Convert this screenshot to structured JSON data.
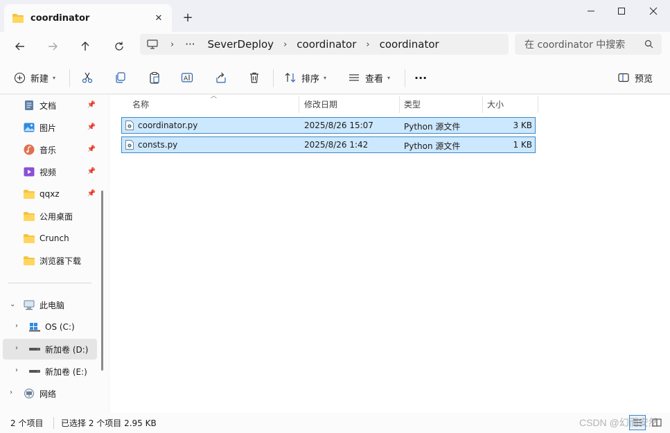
{
  "window": {
    "tab_title": "coordinator",
    "tab_icon": "folder-icon",
    "new_tab": "+",
    "controls": [
      "minimize",
      "maximize",
      "close"
    ]
  },
  "address": {
    "crumbs": [
      "SeverDeploy",
      "coordinator",
      "coordinator"
    ],
    "ellipsis": "···",
    "search_placeholder": "在 coordinator 中搜索"
  },
  "toolbar": {
    "new_label": "新建",
    "sort_label": "排序",
    "view_label": "查看",
    "more_label": "···",
    "preview_label": "预览"
  },
  "sidebar": {
    "quick": [
      {
        "label": "文档",
        "icon": "documents-icon"
      },
      {
        "label": "图片",
        "icon": "pictures-icon"
      },
      {
        "label": "音乐",
        "icon": "music-icon"
      },
      {
        "label": "视频",
        "icon": "videos-icon"
      },
      {
        "label": "qqxz",
        "icon": "folder-icon"
      },
      {
        "label": "公用桌面",
        "icon": "folder-icon"
      },
      {
        "label": "Crunch",
        "icon": "folder-icon"
      },
      {
        "label": "浏览器下载",
        "icon": "folder-icon"
      }
    ],
    "this_pc": "此电脑",
    "drives": [
      {
        "label": "OS (C:)",
        "icon": "windows-drive-icon"
      },
      {
        "label": "新加卷 (D:)",
        "icon": "drive-icon"
      },
      {
        "label": "新加卷 (E:)",
        "icon": "drive-icon"
      }
    ],
    "network": "网络"
  },
  "columns": {
    "name": "名称",
    "modified": "修改日期",
    "type": "类型",
    "size": "大小"
  },
  "files": [
    {
      "name": "coordinator.py",
      "modified": "2025/8/26 15:07",
      "type": "Python 源文件",
      "size": "3 KB"
    },
    {
      "name": "consts.py",
      "modified": "2025/8/26 1:42",
      "type": "Python 源文件",
      "size": "1 KB"
    }
  ],
  "status": {
    "count": "2 个项目",
    "selected": "已选择 2 个项目  2.95 KB"
  },
  "watermark": "CSDN @幻而安然",
  "colors": {
    "selection_bg": "#cce8ff",
    "selection_border": "#3d86c6",
    "folder_yellow": "#f5c242"
  }
}
